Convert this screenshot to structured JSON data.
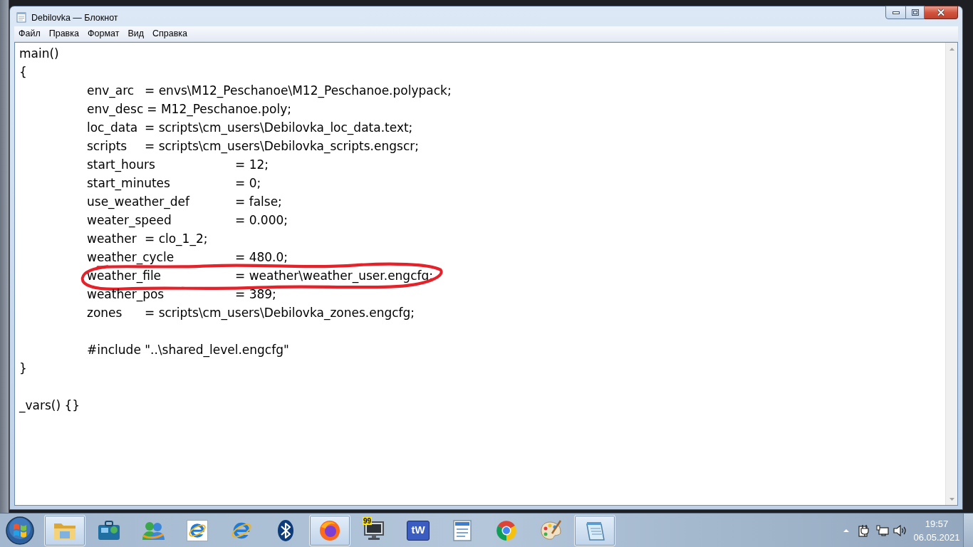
{
  "window": {
    "title": "Debilovka — Блокнот"
  },
  "menu": [
    "Файл",
    "Правка",
    "Формат",
    "Вид",
    "Справка"
  ],
  "editor": {
    "lines": [
      {
        "kind": "plain",
        "text": "main()"
      },
      {
        "kind": "plain",
        "text": "{"
      },
      {
        "kind": "pair",
        "key": "env_arc",
        "value": "= envs\\M12_Peschanoe\\M12_Peschanoe.polypack;",
        "circled": false
      },
      {
        "kind": "pair",
        "key": "env_desc",
        "value": "= M12_Peschanoe.poly;",
        "circled": false
      },
      {
        "kind": "pair",
        "key": "loc_data",
        "value": "= scripts\\cm_users\\Debilovka_loc_data.text;",
        "circled": false
      },
      {
        "kind": "pair",
        "key": "scripts",
        "value": "= scripts\\cm_users\\Debilovka_scripts.engscr;",
        "circled": false
      },
      {
        "kind": "widepair",
        "key": "start_hours",
        "value": "= 12;",
        "circled": false
      },
      {
        "kind": "widepair",
        "key": "start_minutes",
        "value": "= 0;",
        "circled": false
      },
      {
        "kind": "widepair",
        "key": "use_weather_def",
        "value": "= false;",
        "circled": false
      },
      {
        "kind": "widepair",
        "key": "weater_speed",
        "value": "= 0.000;",
        "circled": false
      },
      {
        "kind": "pair",
        "key": "weather",
        "value": "= clo_1_2;",
        "circled": false
      },
      {
        "kind": "widepair",
        "key": "weather_cycle",
        "value": "= 480.0;",
        "circled": false
      },
      {
        "kind": "widepair",
        "key": "weather_file",
        "value": "= weather\\weather_user.engcfg;",
        "circled": true
      },
      {
        "kind": "widepair",
        "key": "weather_pos",
        "value": "= 389;",
        "circled": false
      },
      {
        "kind": "pair",
        "key": "zones",
        "value": "= scripts\\cm_users\\Debilovka_zones.engcfg;",
        "circled": false
      },
      {
        "kind": "blank"
      },
      {
        "kind": "indented",
        "text": "#include \"..\\shared_level.engcfg\""
      },
      {
        "kind": "plain",
        "text": "}"
      },
      {
        "kind": "blank"
      },
      {
        "kind": "plain",
        "text": "_vars() {}"
      }
    ]
  },
  "taskbar": {
    "apps": [
      {
        "running": true
      },
      {
        "running": false
      },
      {
        "running": false
      },
      {
        "running": false
      },
      {
        "running": false
      },
      {
        "running": false
      },
      {
        "running": true
      },
      {
        "running": false,
        "badge": "99"
      },
      {
        "running": false,
        "label": "tW"
      },
      {
        "running": false
      },
      {
        "running": false
      },
      {
        "running": false
      },
      {
        "running": true
      }
    ],
    "tray": {
      "time": "19:57",
      "date": "06.05.2021"
    }
  }
}
